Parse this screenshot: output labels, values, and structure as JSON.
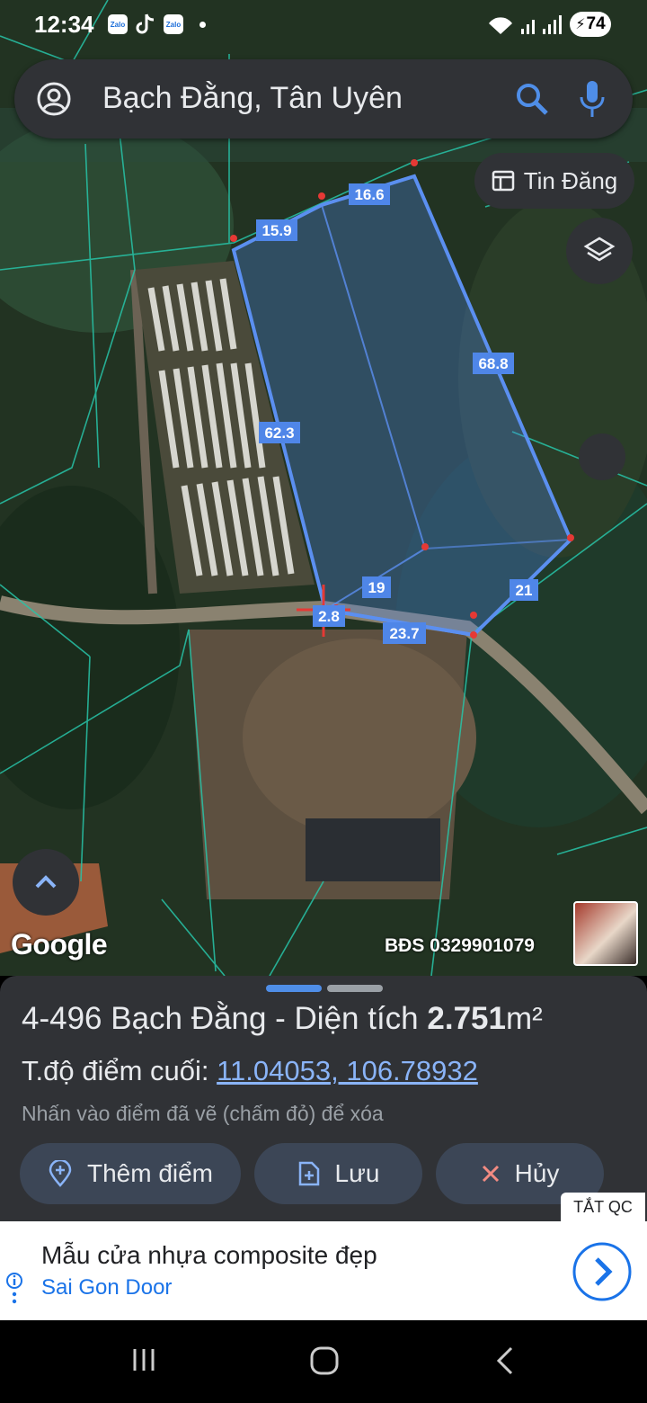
{
  "status_bar": {
    "time": "12:34",
    "apps": [
      "Zalo",
      "Zalo"
    ],
    "battery": "74"
  },
  "search": {
    "query": "Bạch Đằng, Tân Uyên"
  },
  "map": {
    "tin_dang_label": "Tin Đăng",
    "plot_labels": {
      "top_left": "16.6",
      "left_top": "15.9",
      "right": "68.8",
      "left": "62.3",
      "middle": "19",
      "right_bottom": "21",
      "bottom_small": "2.8",
      "bottom": "23.7"
    },
    "google_logo": "Google",
    "watermark": "BĐS 0329901079"
  },
  "sheet": {
    "title_prefix": "4-496 Bạch Đằng - Diện tích ",
    "title_area": "2.751",
    "title_unit": "m²",
    "coord_label": "T.độ điểm cuối: ",
    "coord_value": "11.04053, 106.78932",
    "hint": "Nhấn vào điểm đã vẽ (chấm đỏ) để xóa",
    "add_point_label": "Thêm điểm",
    "save_label": "Lưu",
    "cancel_label": "Hủy"
  },
  "ad": {
    "close_label": "TẮT QC",
    "headline": "Mẫu cửa nhựa composite đẹp",
    "advertiser": "Sai Gon Door"
  },
  "colors": {
    "plot_fill": "#4f86e8",
    "parcel_lines": "#27c4a8",
    "accent_blue": "#8ab4f8",
    "sheet_bg": "#303236"
  }
}
